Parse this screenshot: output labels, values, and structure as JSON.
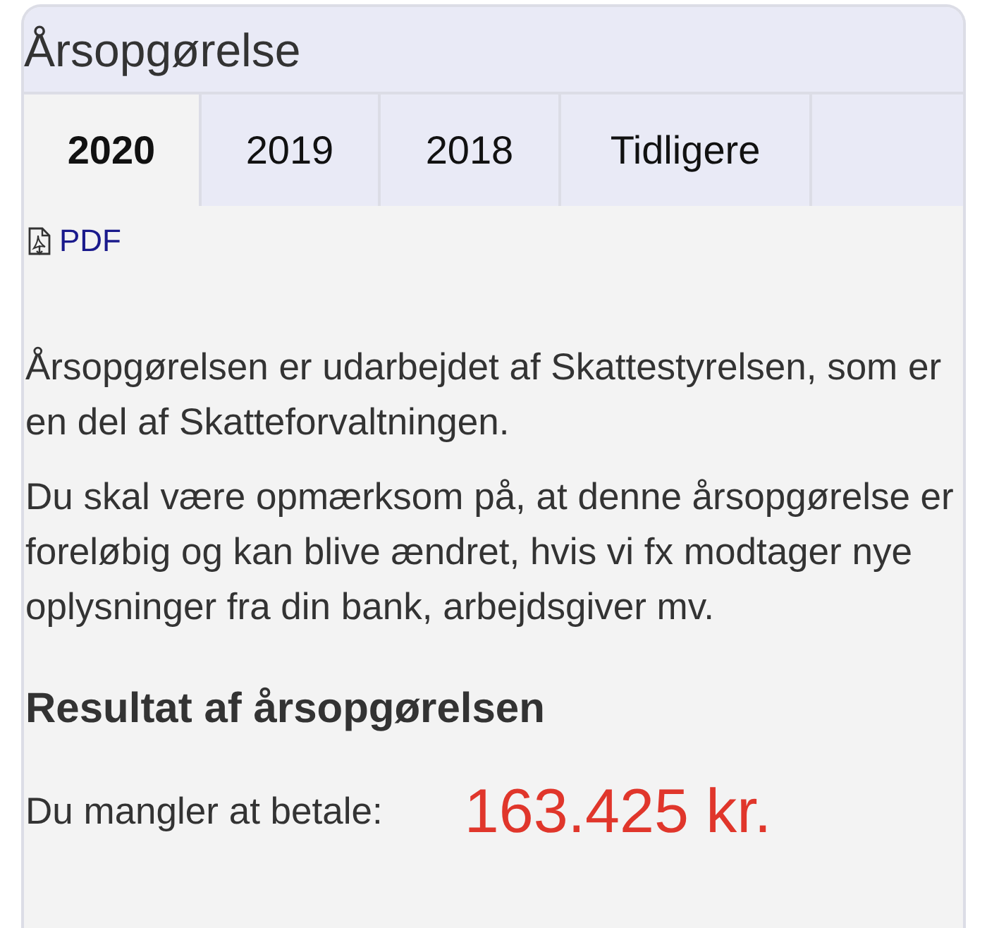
{
  "title": "Årsopgørelse",
  "tabs": [
    {
      "label": "2020",
      "selected": true
    },
    {
      "label": "2019",
      "selected": false
    },
    {
      "label": "2018",
      "selected": false
    },
    {
      "label": "Tidligere",
      "selected": false
    }
  ],
  "pdf_link": "PDF",
  "paragraphs": [
    "Årsopgørelsen er udarbejdet af Skattestyrelsen, som er en del af Skatteforvaltningen.",
    "Du skal være opmærksom på, at denne årsopgørelse er foreløbig og kan blive ændret, hvis vi fx modtager nye oplysninger fra din bank, arbejdsgiver mv."
  ],
  "result": {
    "heading": "Resultat af årsopgørelsen",
    "label": "Du mangler at betale:",
    "amount": "163.425 kr."
  }
}
